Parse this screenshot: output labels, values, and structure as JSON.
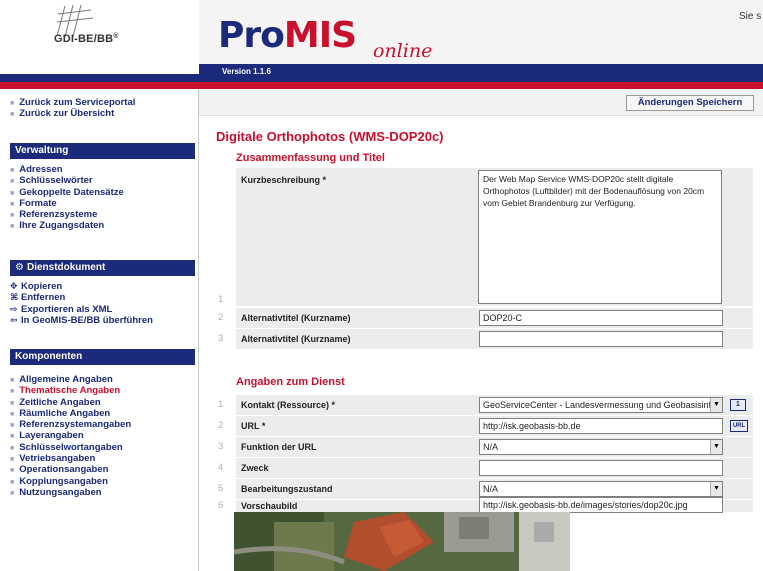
{
  "header": {
    "logo_text": "GDI-BE/BB",
    "logo_reg": "®",
    "brand_pro": "Pro",
    "brand_mis": "MIS",
    "brand_online": "online",
    "version": "Version 1.1.6",
    "topright_text": "Sie s"
  },
  "sidebar": {
    "top_links": [
      {
        "label": "Zurück zum Serviceportal"
      },
      {
        "label": "Zurück zur Übersicht"
      }
    ],
    "verwaltung": {
      "title": "Verwaltung",
      "items": [
        {
          "label": "Adressen"
        },
        {
          "label": "Schlüsselwörter"
        },
        {
          "label": "Gekoppelte Datensätze"
        },
        {
          "label": "Formate"
        },
        {
          "label": "Referenzsysteme"
        },
        {
          "label": "Ihre Zugangsdaten"
        }
      ]
    },
    "dienstdokument": {
      "title": "Dienstdokument",
      "items": [
        {
          "label": "Kopieren",
          "icon": "copy-icon"
        },
        {
          "label": "Entfernen",
          "icon": "remove-icon"
        },
        {
          "label": "Exportieren als XML",
          "icon": "export-icon"
        },
        {
          "label": "In GeoMIS-BE/BB überführen",
          "icon": "transfer-icon"
        }
      ]
    },
    "komponenten": {
      "title": "Komponenten",
      "active_index": 1,
      "items": [
        {
          "label": "Allgemeine Angaben"
        },
        {
          "label": "Thematische Angaben"
        },
        {
          "label": "Zeitliche Angaben"
        },
        {
          "label": "Räumliche Angaben"
        },
        {
          "label": "Referenzsystemangaben"
        },
        {
          "label": "Layerangaben"
        },
        {
          "label": "Schlüsselwortangaben"
        },
        {
          "label": "Vetriebsangaben"
        },
        {
          "label": "Operationsangaben"
        },
        {
          "label": "Kopplungsangaben"
        },
        {
          "label": "Nutzungsangaben"
        }
      ]
    }
  },
  "main": {
    "save_label": "Änderungen Speichern",
    "page_title": "Digitale Orthophotos (WMS-DOP20c)",
    "section1": {
      "title": "Zusammenfassung und Titel",
      "rows": [
        {
          "num": "1",
          "label": "Kurzbeschreibung *",
          "value": "Der Web Map Service WMS-DOP20c stellt digitale Orthophotos (Luftbilder) mit der Bodenauflösung von 20cm vom Gebiet Brandenburg zur Verfügung."
        },
        {
          "num": "2",
          "label": "Alternativtitel (Kurzname)",
          "value": "DOP20-C"
        },
        {
          "num": "3",
          "label": "Alternativtitel (Kurzname)",
          "value": ""
        }
      ]
    },
    "section2": {
      "title": "Angaben zum Dienst",
      "rows": [
        {
          "num": "1",
          "label": "Kontakt (Ressource) *",
          "value": "GeoServiceCenter - Landesvermessung und Geobasisinfo",
          "type": "select",
          "button": "1"
        },
        {
          "num": "2",
          "label": "URL *",
          "value": "http://isk.geobasis-bb.de",
          "type": "text",
          "button": "URL"
        },
        {
          "num": "3",
          "label": "Funktion der URL",
          "value": "N/A",
          "type": "select"
        },
        {
          "num": "4",
          "label": "Zweck",
          "value": "",
          "type": "text"
        },
        {
          "num": "5",
          "label": "Bearbeitungszustand",
          "value": "N/A",
          "type": "select"
        },
        {
          "num": "6",
          "label": "Vorschaubild",
          "value": "http://isk.geobasis-bb.de/images/stories/dop20c.jpg",
          "type": "text"
        }
      ]
    }
  }
}
